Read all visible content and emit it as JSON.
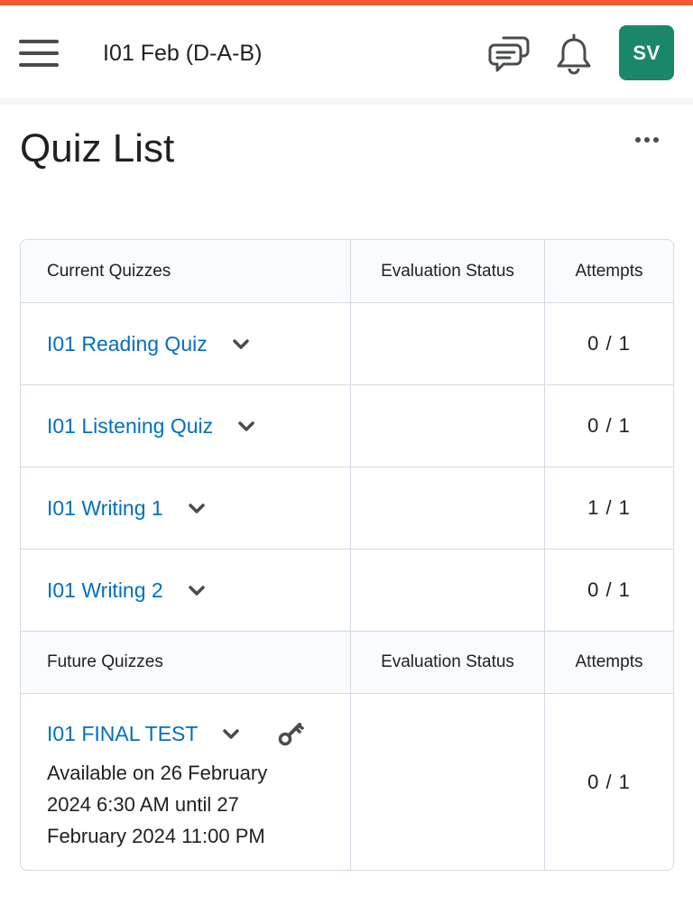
{
  "header": {
    "course_title": "I01 Feb (D-A-B)",
    "avatar_initials": "SV",
    "accent_color": "#f05a32",
    "avatar_color": "#1b8769"
  },
  "page": {
    "title": "Quiz List"
  },
  "current_section": {
    "headers": [
      "Current Quizzes",
      "Evaluation Status",
      "Attempts"
    ],
    "quizzes": [
      {
        "name": "I01 Reading Quiz",
        "evaluation_status": "",
        "attempts": "0 / 1"
      },
      {
        "name": "I01 Listening Quiz",
        "evaluation_status": "",
        "attempts": "0 / 1"
      },
      {
        "name": "I01 Writing 1",
        "evaluation_status": "",
        "attempts": "1 / 1"
      },
      {
        "name": "I01 Writing 2",
        "evaluation_status": "",
        "attempts": "0 / 1"
      }
    ]
  },
  "future_section": {
    "headers": [
      "Future Quizzes",
      "Evaluation Status",
      "Attempts"
    ],
    "quizzes": [
      {
        "name": "I01 FINAL TEST",
        "availability": "Available on 26 February 2024 6:30 AM until 27 February 2024 11:00 PM",
        "evaluation_status": "",
        "attempts": "0 / 1"
      }
    ]
  },
  "colors": {
    "link": "#006fbf",
    "border": "#d3d9e3",
    "header_bg": "#f9fbff"
  },
  "icons": {
    "menu": "hamburger-menu-icon",
    "chat": "chat-bubbles-icon",
    "notifications": "bell-icon",
    "more": "more-options-icon",
    "expand": "chevron-down-icon",
    "restricted": "key-icon"
  }
}
